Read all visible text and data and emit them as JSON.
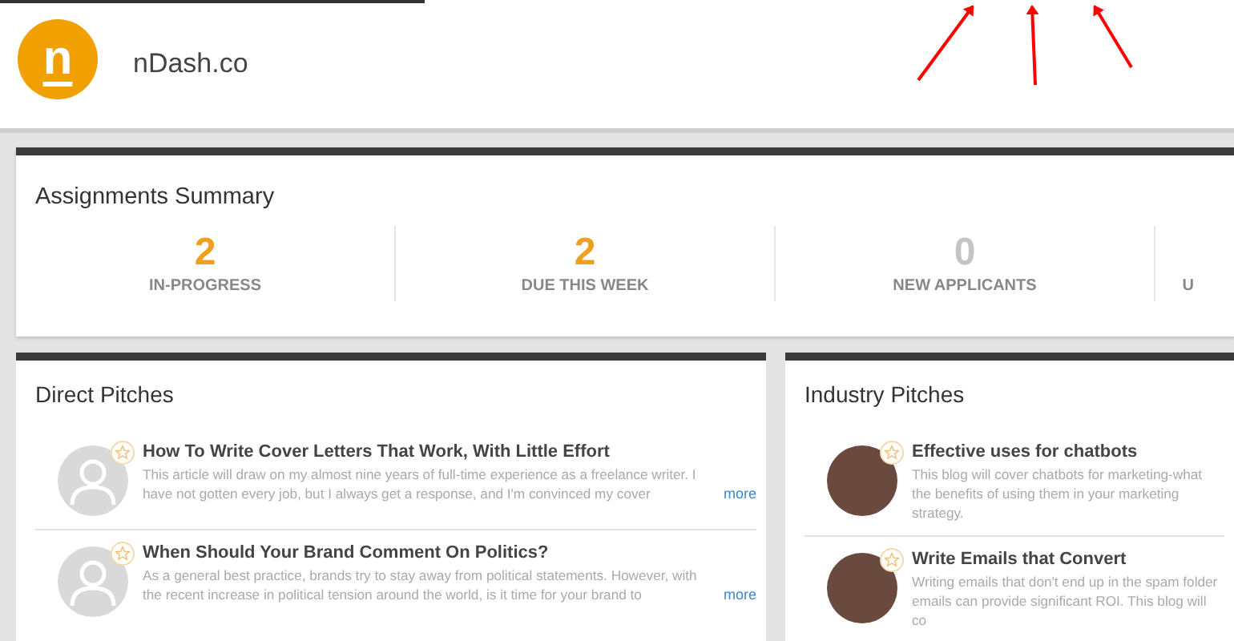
{
  "header": {
    "logo_letter": "n",
    "brand": "nDash.co"
  },
  "summary": {
    "title": "Assignments Summary",
    "stats": [
      {
        "value": "2",
        "label": "IN-PROGRESS",
        "color": "#f0a020"
      },
      {
        "value": "2",
        "label": "DUE THIS WEEK",
        "color": "#f0a020"
      },
      {
        "value": "0",
        "label": "NEW APPLICANTS",
        "color": "#c4c4c4"
      },
      {
        "label": "U"
      }
    ]
  },
  "panels": [
    {
      "title": "Direct Pitches",
      "items": [
        {
          "kind": "silhouette",
          "title": "How To Write Cover Letters That Work, With Little Effort",
          "description": "This article will draw on my almost nine years of full-time experience as a freelance writer. I have not gotten every job, but I always get a response, and I'm convinced my cover",
          "more": "more"
        },
        {
          "kind": "silhouette",
          "title": "When Should Your Brand Comment On Politics?",
          "description": "As a general best practice, brands try to stay away from political statements. However, with the recent increase in political tension around the world, is it time for your brand to",
          "more": "more"
        }
      ]
    },
    {
      "title": "Industry Pitches",
      "items": [
        {
          "kind": "photo",
          "title": "Effective uses for chatbots",
          "description": "This blog will cover chatbots for marketing-what the benefits of using them in your marketing strategy."
        },
        {
          "kind": "photo",
          "title": "Write Emails that Convert",
          "description": "Writing emails that don't end up in the spam folder emails can provide significant ROI. This blog will co"
        }
      ]
    }
  ]
}
